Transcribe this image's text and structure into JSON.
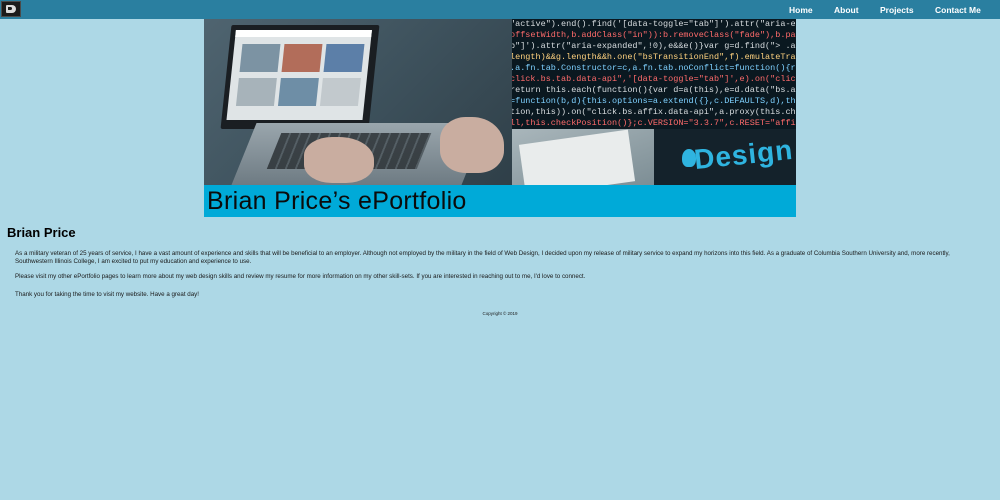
{
  "navbar": {
    "logo_icon": "ep-logo-icon",
    "links": [
      "Home",
      "About",
      "Projects",
      "Contact Me"
    ]
  },
  "banner": {
    "title": "Brian Price’s ePortfolio",
    "design_word": "Design",
    "code_lines": [
      "\"active\").end().find('[data-toggle=\"tab\"]').attr(\"aria-expanded\",!1),",
      "offsetWidth,b.addClass(\"in\")):b.removeClass(\"fade\"),b.parent(\".dropdo",
      "b\"]').attr(\"aria-expanded\",!0),e&&e()}var g=d.find(\"> .active\"),h=e&&",
      "length)&&g.length&&h.one(\"bsTransitionEnd\",f).emulateTransitionEnd",
      ".a.fn.tab.Constructor=c,a.fn.tab.noConflict=function(){return a.fn.t",
      "click.bs.tab.data-api\",'[data-toggle=\"tab\"]',e).on(\"click.bs.tab.dat",
      "return this.each(function(){var d=a(this),e=d.data(\"bs.affix\"),f=\"ob",
      "=function(b,d){this.options=a.extend({},c.DEFAULTS,d),this.$target=a",
      "tion,this)).on(\"click.bs.affix.data-api\",a.proxy(this.checkPositionWi",
      "ll,this.checkPosition()};c.VERSION=\"3.3.7\",c.RESET=\"affix affix-top"
    ],
    "accent_color": "#00aad8"
  },
  "content": {
    "heading": "Brian Price",
    "paragraphs": [
      "As a military veteran of 25 years of service, I have a vast amount of experience and skills that will be beneficial to an employer. Although not employed by the military in the field of Web Design, I decided upon my release of military service to expand my horizons into this field. As a graduate of Columbia Southern University and, more recently, Southwestern Illinois College, I am excited to put my education and experience to use.",
      "Please visit my other ePortfolio pages to learn more about my web design skills and review my resume for more information on my other skill-sets. If you are interested in reaching out to me, I'd love to connect.",
      "Thank you for taking the time to visit my website. Have a great day!"
    ]
  },
  "footer": {
    "copyright": "Copyright © 2019"
  },
  "colors": {
    "page_background": "#add8e6",
    "navbar_background": "#2a7fa0",
    "nav_text": "#ffffff"
  }
}
